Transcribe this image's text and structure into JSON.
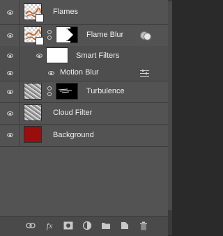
{
  "layers": {
    "flames": {
      "name": "Flames",
      "visible": true,
      "thumbnail": "transparent-checker-with-flame",
      "icon": "eye-icon"
    },
    "flame_blur": {
      "name": "Flame Blur",
      "visible": true,
      "thumbnail": "transparent-checker-with-flame",
      "mask": "white-with-black-chevron",
      "linked": true,
      "badge": "smart-filter-badge"
    },
    "smart_filters": {
      "name": "Smart Filters",
      "visible": true,
      "mask": "white"
    },
    "motion_blur": {
      "name": "Motion Blur",
      "visible": true,
      "icon": "filter-blending-options-icon"
    },
    "turbulence": {
      "name": "Turbulence",
      "visible": true,
      "thumbnail": "noise",
      "mask": "black-with-white-streaks",
      "linked": true
    },
    "cloud_filter": {
      "name": "Cloud Filter",
      "visible": true,
      "thumbnail": "noise"
    },
    "background": {
      "name": "Background",
      "visible": true,
      "thumbnail_color": "#9b0c0c"
    }
  },
  "bottom_toolbar": {
    "icons": [
      "link-layers-icon",
      "fx-icon",
      "add-mask-icon",
      "adjustment-layer-icon",
      "new-group-icon",
      "new-layer-icon",
      "trash-icon"
    ],
    "fx_label": "fx"
  },
  "colors": {
    "panel_bg": "#535353",
    "background_swatch": "#9b0c0c"
  }
}
